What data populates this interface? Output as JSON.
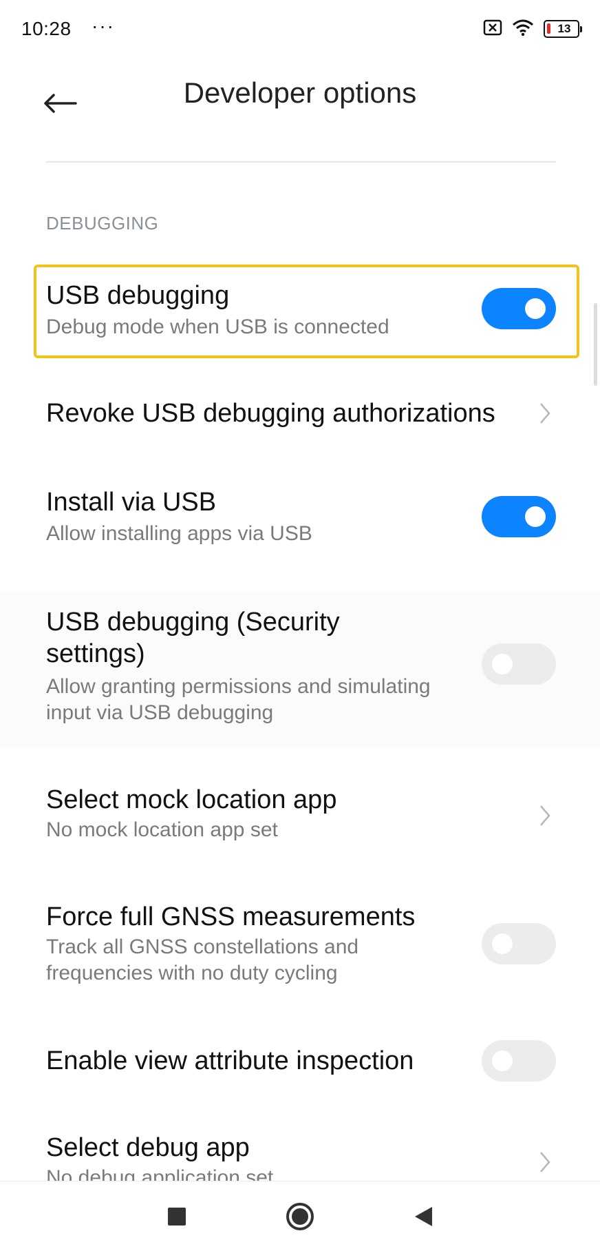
{
  "status_bar": {
    "time": "10:28",
    "overflow": "···",
    "battery_level": "13",
    "icons": [
      "sim-error-icon",
      "wifi-icon",
      "battery-icon"
    ]
  },
  "header": {
    "back_icon": "arrow-left-icon",
    "title": "Developer options"
  },
  "section": {
    "label": "DEBUGGING"
  },
  "settings": [
    {
      "title": "USB debugging",
      "subtitle": "Debug mode when USB is connected",
      "control": "toggle",
      "on": true
    },
    {
      "title": "Revoke USB debugging authorizations",
      "subtitle": "",
      "control": "chevron"
    },
    {
      "title": "Install via USB",
      "subtitle": "Allow installing apps via USB",
      "control": "toggle",
      "on": true
    },
    {
      "title_line1": "USB debugging (Security",
      "title_line2": "settings)",
      "subtitle_line1": "Allow granting permissions and simulating",
      "subtitle_line2": "input via USB debugging",
      "control": "toggle",
      "on": false
    },
    {
      "title": "Select mock location app",
      "subtitle": "No mock location app set",
      "control": "chevron"
    },
    {
      "title": "Force full GNSS measurements",
      "subtitle_line1": "Track all GNSS constellations and",
      "subtitle_line2": "frequencies with no duty cycling",
      "control": "toggle",
      "on": false
    },
    {
      "title": "Enable view attribute inspection",
      "subtitle": "",
      "control": "toggle",
      "on": false
    },
    {
      "title": "Select debug app",
      "subtitle": "No debug application set",
      "control": "chevron"
    }
  ],
  "colors": {
    "toggle_on": "#0d84ff",
    "toggle_off": "#ececec",
    "highlight": "#f0c419"
  },
  "nav_bar": {
    "recents_icon": "square-icon",
    "home_icon": "circle-home-icon",
    "back_icon": "triangle-back-icon"
  }
}
